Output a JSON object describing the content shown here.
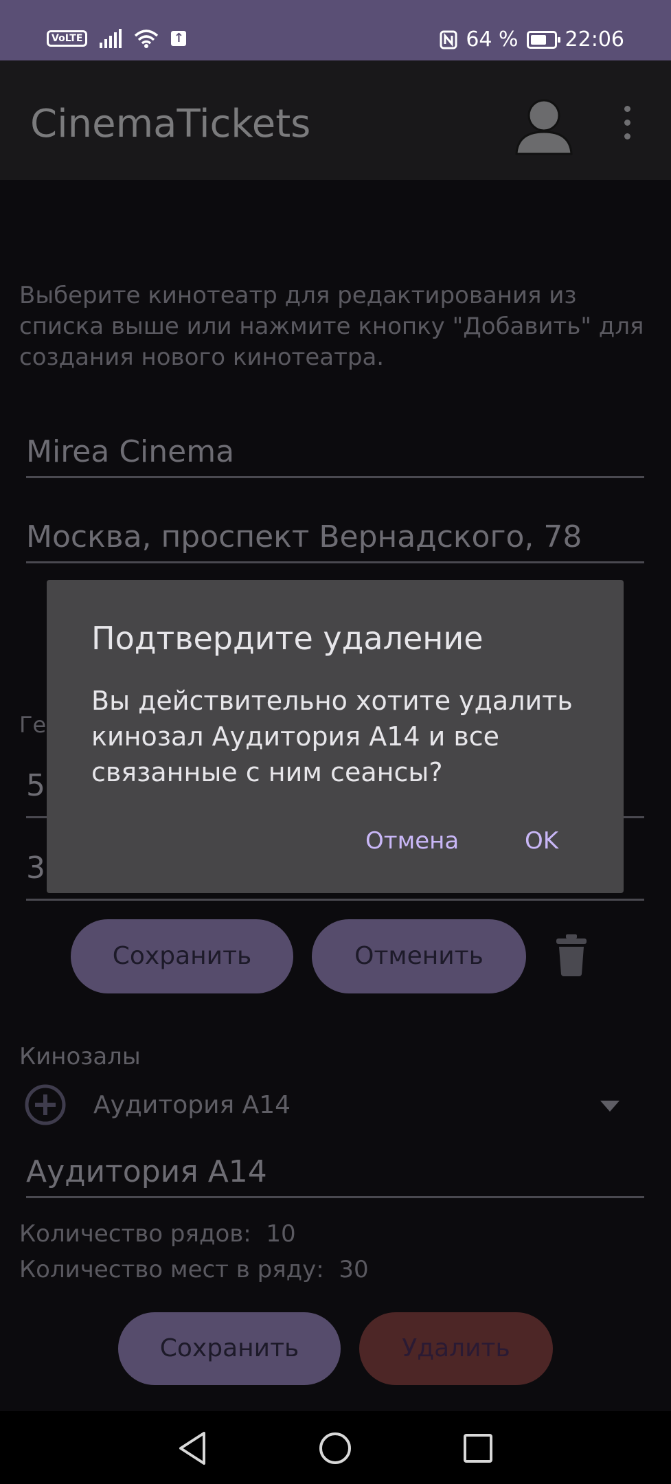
{
  "status_bar": {
    "volte": "VoLTE",
    "battery_percent": "64 %",
    "time": "22:06"
  },
  "app_bar": {
    "title": "CinemaTickets"
  },
  "cinema_editor": {
    "hint": "Выберите кинотеатр для редактирования из списка выше или нажмите кнопку \"Добавить\" для создания нового кинотеатра.",
    "name_value": "Mirea Cinema",
    "address_value": "Москва, проспект Вернадского, 78",
    "geo_label": "Ге",
    "latitude_value": "5",
    "longitude_value": "3",
    "save_label": "Сохранить",
    "cancel_label": "Отменить"
  },
  "halls": {
    "label": "Кинозалы",
    "selected_hall": "Аудитория А14",
    "hall_name_value": "Аудитория А14",
    "rows_label": "Количество рядов:",
    "rows_value": "10",
    "seats_label": "Количество мест в ряду:",
    "seats_value": "30",
    "save_label": "Сохранить",
    "delete_label": "Удалить"
  },
  "dialog": {
    "title": "Подтвердите удаление",
    "message": "Вы действительно хотите удалить кинозал Аудитория А14 и все связанные с ним сеансы?",
    "cancel_label": "Отмена",
    "ok_label": "OK"
  },
  "colors": {
    "status_bar": "#5a4f75",
    "accent": "#c9b7f7",
    "dialog_bg": "#474648",
    "delete_button": "#4d2626"
  }
}
